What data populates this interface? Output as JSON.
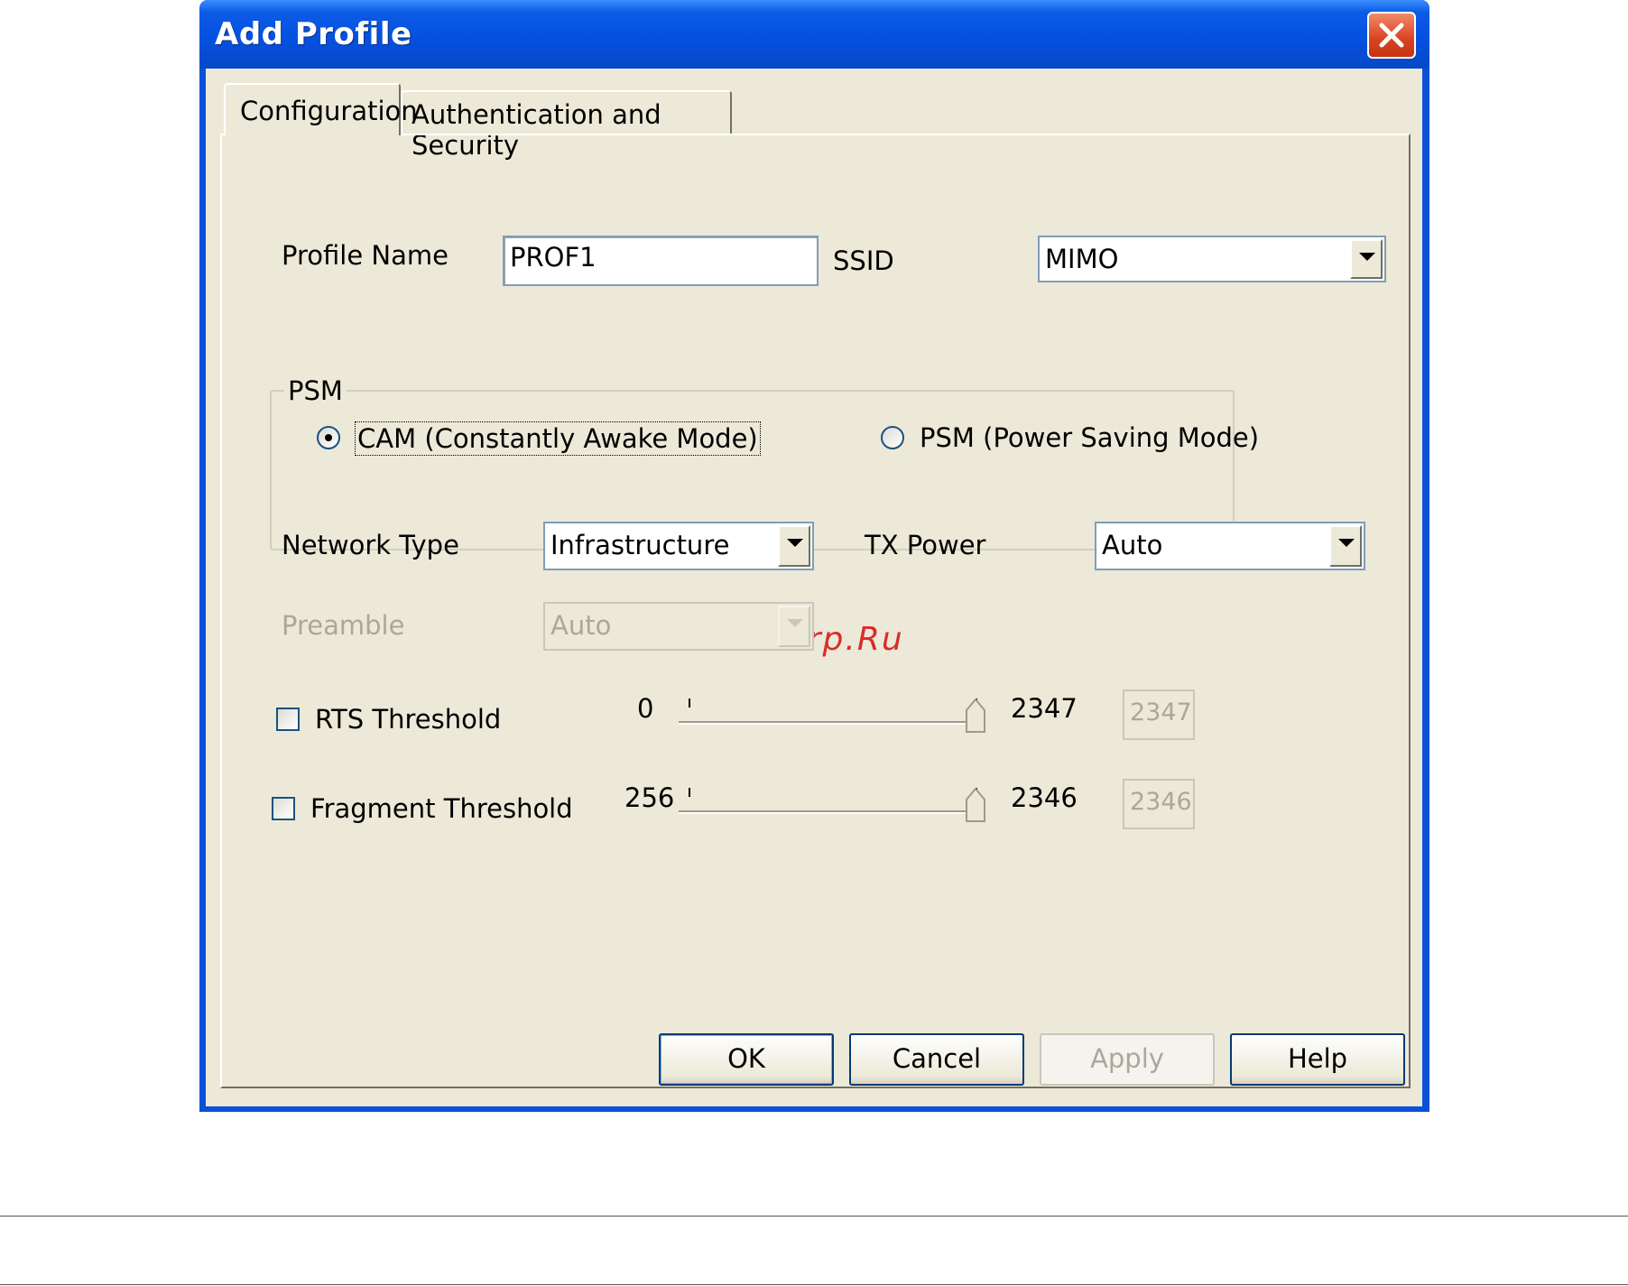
{
  "window": {
    "title": "Add Profile"
  },
  "tabs": [
    {
      "label": "Configuration",
      "active": true
    },
    {
      "label": "Authentication and Security",
      "active": false
    }
  ],
  "profile": {
    "name_label": "Profile Name",
    "name_value": "PROF1"
  },
  "ssid": {
    "label": "SSID",
    "value": "MIMO"
  },
  "psm": {
    "legend": "PSM",
    "options": [
      {
        "label": "CAM (Constantly Awake Mode)",
        "selected": true
      },
      {
        "label": "PSM (Power Saving Mode)",
        "selected": false
      }
    ]
  },
  "network_type": {
    "label": "Network Type",
    "value": "Infrastructure"
  },
  "tx_power": {
    "label": "TX Power",
    "value": "Auto"
  },
  "preamble": {
    "label": "Preamble",
    "value": "Auto",
    "enabled": false
  },
  "rts": {
    "label": "RTS Threshold",
    "checked": false,
    "min": "0",
    "max": "2347",
    "value": "2347"
  },
  "fragment": {
    "label": "Fragment Threshold",
    "checked": false,
    "min": "256",
    "max": "2346",
    "value": "2346"
  },
  "buttons": {
    "ok": "OK",
    "cancel": "Cancel",
    "apply": "Apply",
    "help": "Help"
  },
  "watermark": "McGrp.Ru",
  "colors": {
    "titlebar": "#0551e0",
    "dialog_bg": "#ece9d8",
    "close": "#d8431f",
    "watermark": "#dd2a2a"
  }
}
